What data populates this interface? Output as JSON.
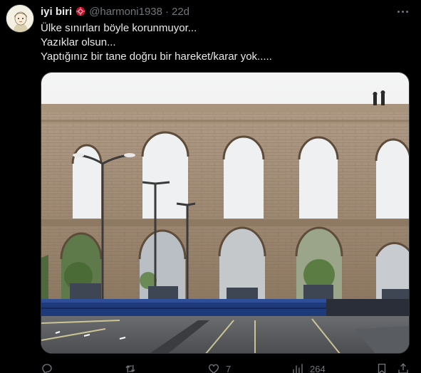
{
  "user": {
    "display_name": "iyi biri",
    "handle": "@harmoni1938",
    "separator": "·",
    "time": "22d"
  },
  "post": {
    "lines": [
      "Ülke sınırları böyle korunmuyor...",
      "Yazıklar olsun...",
      "Yaptığınız bir tane doğru bir hareket/karar yok....."
    ]
  },
  "actions": {
    "reply_count": "",
    "repost_count": "",
    "like_count": "7",
    "views_count": "264"
  },
  "icons": [
    "avatar",
    "badge-icon",
    "more-icon",
    "reply-icon",
    "repost-icon",
    "like-icon",
    "views-icon",
    "bookmark-icon",
    "share-icon"
  ],
  "colors": {
    "background": "#000000",
    "text_primary": "#e7e9ea",
    "text_secondary": "#71767b",
    "border": "#2f3336",
    "badge_red": "#c8102e"
  }
}
